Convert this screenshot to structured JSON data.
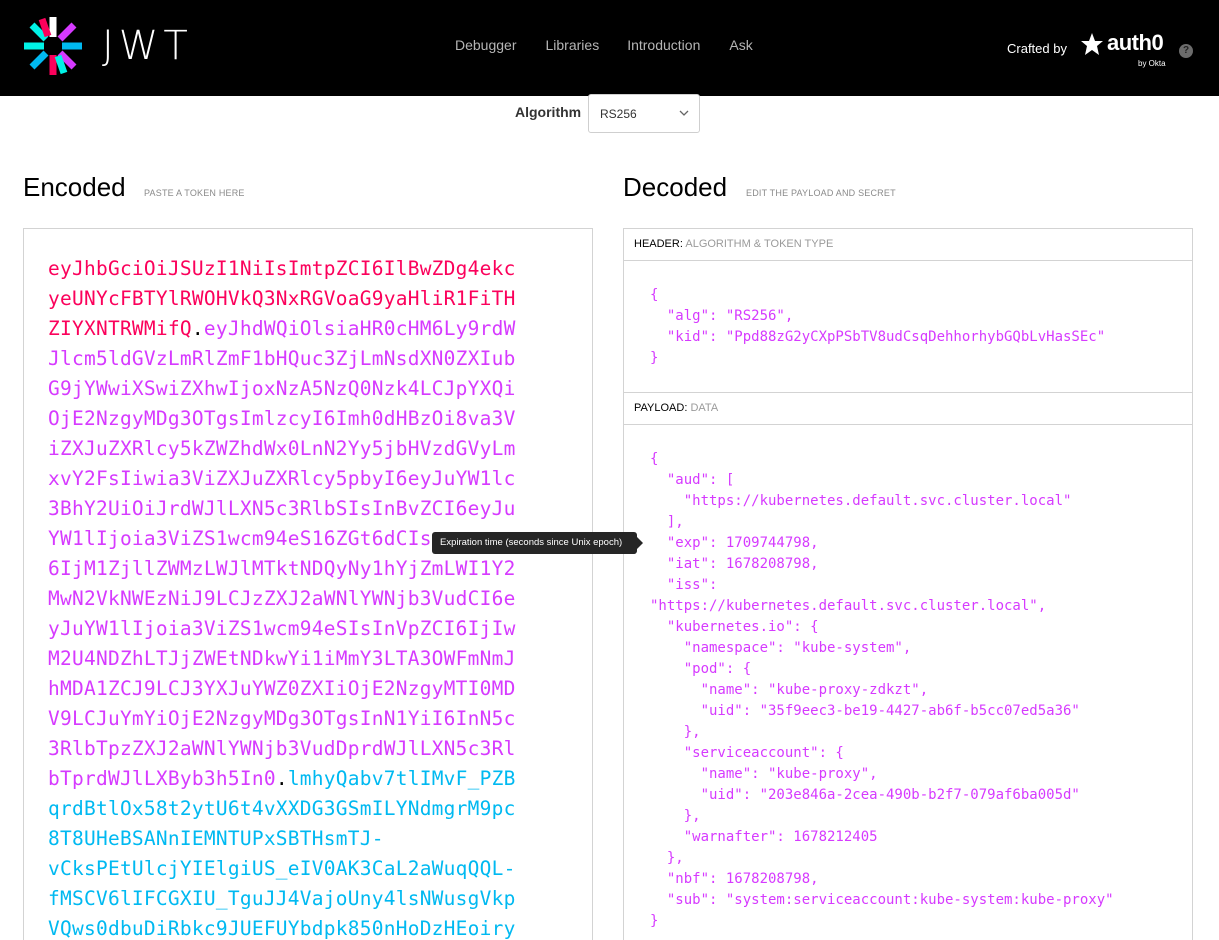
{
  "brand": {
    "logo_text": "JWT",
    "crafted_by": "Crafted by",
    "auth0_text": "auth0",
    "okta_text": "by Okta",
    "help_text": "?"
  },
  "nav": [
    {
      "label": "Debugger"
    },
    {
      "label": "Libraries"
    },
    {
      "label": "Introduction"
    },
    {
      "label": "Ask"
    }
  ],
  "algorithm": {
    "label": "Algorithm",
    "selected": "RS256"
  },
  "encoded": {
    "title": "Encoded",
    "subtitle": "PASTE A TOKEN HERE",
    "lines": [
      [
        [
          "h",
          "eyJhbGciOiJSUzI1NiIsImtpZCI6IlBwZDg4ekc"
        ]
      ],
      [
        [
          "h",
          "yeUNYcFBTYlRWOHVkQ3NxRGVoaG9yaHliR1FiTH"
        ]
      ],
      [
        [
          "h",
          "ZIYXNTRWMifQ"
        ],
        [
          "d",
          "."
        ],
        [
          "p",
          "eyJhdWQiOlsiaHR0cHM6Ly9rdW"
        ]
      ],
      [
        [
          "p",
          "Jlcm5ldGVzLmRlZmF1bHQuc3ZjLmNsdXN0ZXIub"
        ]
      ],
      [
        [
          "p",
          "G9jYWwiXSwiZXhwIjoxNzA5NzQ0Nzk4LCJpYXQi"
        ]
      ],
      [
        [
          "p",
          "OjE2NzgyMDg3OTgsImlzcyI6Imh0dHBzOi8va3V"
        ]
      ],
      [
        [
          "p",
          "iZXJuZXRlcy5kZWZhdWx0LnN2Yy5jbHVzdGVyLm"
        ]
      ],
      [
        [
          "p",
          "xvY2FsIiwia3ViZXJuZXRlcy5pbyI6eyJuYW1lc"
        ]
      ],
      [
        [
          "p",
          "3BhY2UiOiJrdWJlLXN5c3RlbSIsInBvZCI6eyJu"
        ]
      ],
      [
        [
          "p",
          "YW1lIjoia3ViZS1wcm94eS16ZGt6dCIs"
        ]
      ],
      [
        [
          "p",
          "6IjM1ZjllZWMzLWJlMTktNDQyNy1hYjZmLWI1Y2"
        ]
      ],
      [
        [
          "p",
          "MwN2VkNWEzNiJ9LCJzZXJ2aWNlYWNjb3VudCI6e"
        ]
      ],
      [
        [
          "p",
          "yJuYW1lIjoia3ViZS1wcm94eSIsInVpZCI6IjIw"
        ]
      ],
      [
        [
          "p",
          "M2U4NDZhLTJjZWEtNDkwYi1iMmY3LTA3OWFmNmJ"
        ]
      ],
      [
        [
          "p",
          "hMDA1ZCJ9LCJ3YXJuYWZ0ZXIiOjE2NzgyMTI0MD"
        ]
      ],
      [
        [
          "p",
          "V9LCJuYmYiOjE2NzgyMDg3OTgsInN1YiI6InN5c"
        ]
      ],
      [
        [
          "p",
          "3RlbTpzZXJ2aWNlYWNjb3VudDprdWJlLXN5c3Rl"
        ]
      ],
      [
        [
          "p",
          "bTprdWJlLXByb3h5In0"
        ],
        [
          "d",
          "."
        ],
        [
          "s",
          "lmhyQabv7tlIMvF_PZB"
        ]
      ],
      [
        [
          "s",
          "qrdBtlOx58t2ytU6t4vXXDG3GSmILYNdmgrM9pc"
        ]
      ],
      [
        [
          "s",
          "8T8UHeBSANnIEMNTUPxSBTHsmTJ-"
        ]
      ],
      [
        [
          "s",
          "vCksPEtUlcjYIElgiUS_eIV0AK3CaL2aWuqQQL-"
        ]
      ],
      [
        [
          "s",
          "fMSCV6lIFCGXIU_TguJJ4VajoUny4lsNWusgVkp"
        ]
      ],
      [
        [
          "s",
          "VQws0dbuDiRbkc9JUEFUYbdpk850nHoDzHEoiry"
        ]
      ]
    ]
  },
  "decoded": {
    "title": "Decoded",
    "subtitle": "EDIT THE PAYLOAD AND SECRET",
    "header_section": {
      "key": "HEADER:",
      "sub": "ALGORITHM & TOKEN TYPE"
    },
    "payload_section": {
      "key": "PAYLOAD:",
      "sub": "DATA"
    },
    "header_json": [
      "{",
      "  \"alg\": \"RS256\",",
      "  \"kid\": \"Ppd88zG2yCXpPSbTV8udCsqDehhorhybGQbLvHasSEc\"",
      "}"
    ],
    "payload_json": [
      "{",
      "  \"aud\": [",
      "    \"https://kubernetes.default.svc.cluster.local\"",
      "  ],",
      "  \"exp\": 1709744798,",
      "  \"iat\": 1678208798,",
      "  \"iss\":",
      "\"https://kubernetes.default.svc.cluster.local\",",
      "  \"kubernetes.io\": {",
      "    \"namespace\": \"kube-system\",",
      "    \"pod\": {",
      "      \"name\": \"kube-proxy-zdkzt\",",
      "      \"uid\": \"35f9eec3-be19-4427-ab6f-b5cc07ed5a36\"",
      "    },",
      "    \"serviceaccount\": {",
      "      \"name\": \"kube-proxy\",",
      "      \"uid\": \"203e846a-2cea-490b-b2f7-079af6ba005d\"",
      "    },",
      "    \"warnafter\": 1678212405",
      "  },",
      "  \"nbf\": 1678208798,",
      "  \"sub\": \"system:serviceaccount:kube-system:kube-proxy\"",
      "}"
    ]
  },
  "tooltip": {
    "text": "Expiration time (seconds since Unix epoch)"
  },
  "colors": {
    "header": "#fb015b",
    "payload": "#d63aff",
    "signature": "#00b9f1",
    "topbar": "#000000"
  }
}
